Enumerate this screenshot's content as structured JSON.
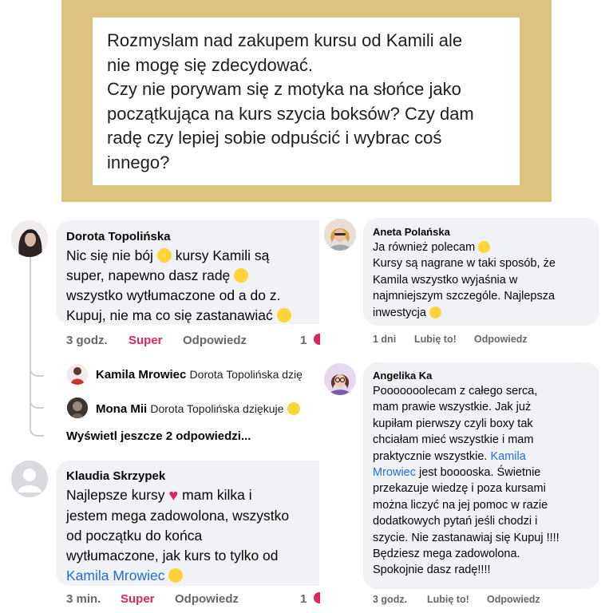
{
  "question": {
    "lines": [
      "Rozmyslam nad zakupem kursu od Kamili ale",
      "nie mogę się zdecydować.",
      "Czy nie porywam się z motyka na słońce jako",
      "początkująca na kurs szycia boksów? Czy dam",
      "radę czy lepiej sobie odpuścić i wybrac coś",
      "innego?"
    ]
  },
  "left": {
    "comment1": {
      "author": "Dorota Topolińska",
      "l1a": "Nic się nie bój",
      "l1b": "kursy Kamili są",
      "l2a": "super, napewno dasz radę",
      "l3": "wszystko wytłumaczone od a do z.",
      "l4a": "Kupuj, nie ma co się zastanawiać",
      "time": "3 godz.",
      "reaction": "Super",
      "reply": "Odpowiedz",
      "count": "1"
    },
    "reply1": {
      "author": "Kamila Mrowiec",
      "text": "Dorota Topolińska dzię"
    },
    "reply2": {
      "author": "Mona Mii",
      "text": "Dorota Topolińska dziękuje"
    },
    "more_replies": "Wyświetl jeszcze 2 odpowiedzi...",
    "comment2": {
      "author": "Klaudia Skrzypek",
      "l1a": "Najlepsze kursy",
      "l1b": "mam kilka i",
      "l2": "jestem mega zadowolona, wszystko",
      "l3": "od początku do końca",
      "l4": "wytłumaczone, jak kurs to tylko od",
      "l5": "Kamila Mrowiec",
      "time": "3 min.",
      "reaction": "Super",
      "reply": "Odpowiedz",
      "count": "1"
    }
  },
  "right": {
    "comment1": {
      "author": "Aneta Polańska",
      "l1": "Ja również polecam",
      "l2": "Kursy są nagrane w taki sposób, że",
      "l3": "Kamila wszystko wyjaśnia w",
      "l4": "najmniejszym szczególe. Najlepsza",
      "l5": "inwestycja",
      "time": "1 dni",
      "like": "Lubię to!",
      "reply": "Odpowiedz"
    },
    "comment2": {
      "author": "Angelika Ka",
      "l1": "Pooooooolecam z całego serca,",
      "l2": "mam prawie wszystkie. Jak już",
      "l3": "kupiłam pierwszy czyli boxy tak",
      "l4": "chciałam mieć wszystkie i mam",
      "l5a": "praktycznie wszystkie.",
      "l5b": "Kamila",
      "l6a": "Mrowiec",
      "l6b": "jest booooska. Świetnie",
      "l7": "przekazuje wiedzę i poza kursami",
      "l8": "można liczyć na jej pomoc w razie",
      "l9": "dodatkowych pytań jeśli chodzi i",
      "l10": "szycie. Nie zastanawiaj się Kupuj !!!!",
      "l11": "Będziesz mega zadowolona.",
      "l12": "Spokojnie dasz radę!!!!",
      "time": "3 godz.",
      "like": "Lubię to!",
      "reply": "Odpowiedz"
    }
  },
  "colors": {
    "bubble": "#f0f2f5",
    "mention": "#216fdb",
    "super": "#e0245e",
    "panel": "#dcc480"
  }
}
